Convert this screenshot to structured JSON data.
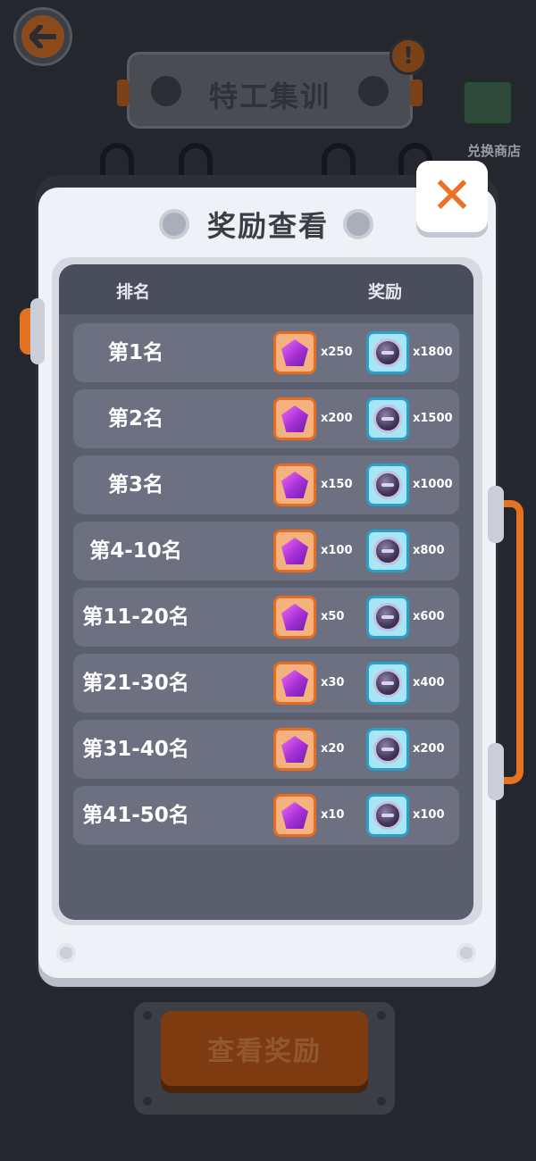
{
  "header": {
    "title": "特工集训",
    "alert_symbol": "!",
    "back_icon": "arrow-left-icon",
    "shop_label": "兑换商店"
  },
  "modal": {
    "title": "奖励查看",
    "close_symbol": "✕",
    "columns": {
      "rank": "排名",
      "reward": "奖励"
    },
    "rows": [
      {
        "rank": "第1名",
        "gems": "x250",
        "coins": "x1800"
      },
      {
        "rank": "第2名",
        "gems": "x200",
        "coins": "x1500"
      },
      {
        "rank": "第3名",
        "gems": "x150",
        "coins": "x1000"
      },
      {
        "rank": "第4-10名",
        "gems": "x100",
        "coins": "x800"
      },
      {
        "rank": "第11-20名",
        "gems": "x50",
        "coins": "x600"
      },
      {
        "rank": "第21-30名",
        "gems": "x30",
        "coins": "x400"
      },
      {
        "rank": "第31-40名",
        "gems": "x20",
        "coins": "x200"
      },
      {
        "rank": "第41-50名",
        "gems": "x10",
        "coins": "x100"
      }
    ]
  },
  "footer": {
    "button_label": "查看奖励"
  },
  "colors": {
    "accent_orange": "#e37322",
    "gem_purple": "#a62fd6",
    "coin_cyan": "#2a9fc7"
  }
}
